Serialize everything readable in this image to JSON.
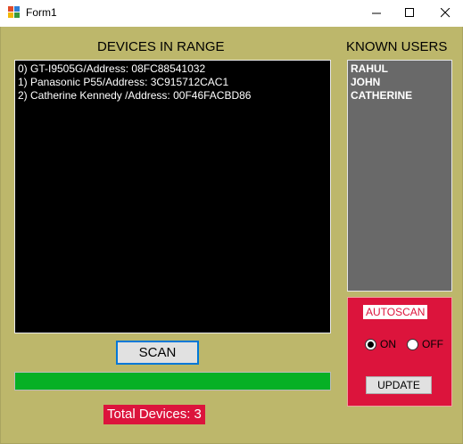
{
  "window": {
    "title": "Form1",
    "icon": "winforms-app-icon",
    "controls": [
      "minimize-icon",
      "maximize-icon",
      "close-icon"
    ]
  },
  "devices": {
    "heading": "DEVICES IN RANGE",
    "items": [
      "0) GT-I9505G/Address: 08FC88541032",
      "1) Panasonic P55/Address: 3C915712CAC1",
      "2) Catherine Kennedy /Address: 00F46FACBD86"
    ]
  },
  "users": {
    "heading": "KNOWN USERS",
    "items": [
      "RAHUL",
      "JOHN",
      "CATHERINE"
    ]
  },
  "scan": {
    "label": "SCAN",
    "progress_percent": 100
  },
  "total": {
    "text": "Total Devices: 3"
  },
  "autoscan": {
    "label": "AUTOSCAN",
    "on_label": "ON",
    "off_label": "OFF",
    "selected": "ON",
    "update_label": "UPDATE"
  },
  "colors": {
    "form_background": "#bdb76b",
    "accent_red": "#dc143c",
    "list_background": "#000000",
    "users_background": "#696969",
    "progress_fill": "#06b025"
  }
}
